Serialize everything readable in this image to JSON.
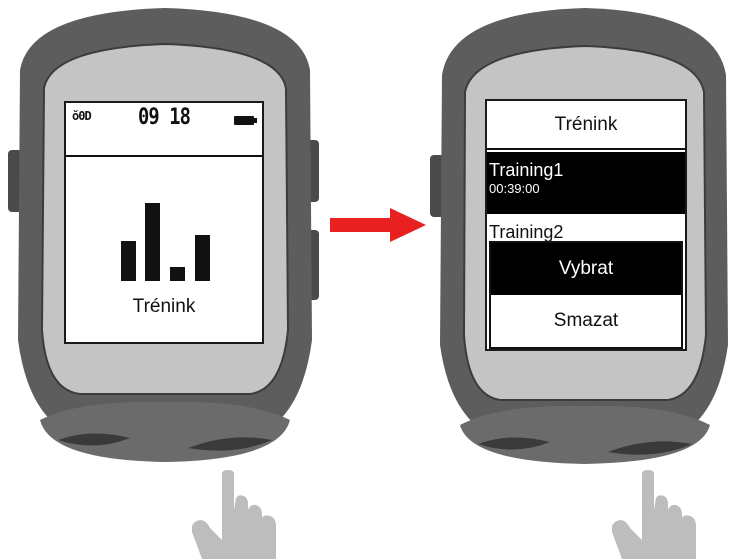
{
  "left_device": {
    "status": {
      "signal_text": "ŏ0D",
      "time": "09 18",
      "battery_icon": "battery-icon"
    },
    "menu_icon": "training-bars-icon",
    "menu_label": "Trénink"
  },
  "arrow_icon": "red-arrow-right-icon",
  "right_device": {
    "header_title": "Trénink",
    "trainings": [
      {
        "name": "Training1",
        "time": "00:39:00"
      },
      {
        "name": "Training2"
      }
    ],
    "popup_options": [
      "Vybrat",
      "Smazat"
    ]
  },
  "hand_icon": "pointing-hand-icon",
  "colors": {
    "device_body": "#5a5a5a",
    "device_inner": "#c3c3c3",
    "arrow": "#e8201f",
    "hand": "#bdbdbd"
  }
}
